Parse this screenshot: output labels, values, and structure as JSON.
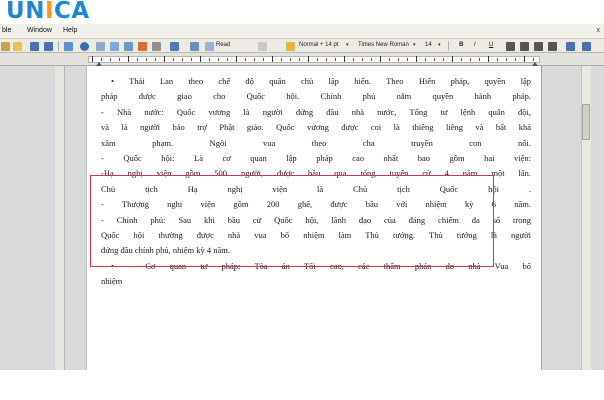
{
  "brand": {
    "logo_u": "U",
    "logo_n": "N",
    "logo_i": "I",
    "logo_c": "C",
    "logo_a": "A"
  },
  "menubar": {
    "item_table": "ble",
    "item_window": "Window",
    "item_help": "Help",
    "right_control": "x"
  },
  "toolbar": {
    "read_label": "Read",
    "style_value": "Normal + 14 pt",
    "font_value": "Times New Roman",
    "size_value": "14",
    "bold": "B",
    "italic": "I",
    "underline": "U"
  },
  "document": {
    "lines": [
      {
        "text": "•  Thái Lan theo chế độ quân chủ lập hiến. Theo Hiến pháp, quyền lập",
        "style": "ind"
      },
      {
        "text": "pháp được giao cho Quốc hội. Chính phủ nắm quyền hành pháp.",
        "style": ""
      },
      {
        "text": "- Nhà nước: Quốc vương là người đứng đầu nhà nước, Tổng tư lệnh quân đội,",
        "style": ""
      },
      {
        "text": "và là người bảo trợ Phật giáo. Quốc vương được coi là thiêng liêng và bất khả",
        "style": ""
      },
      {
        "text": "xâm phạm. Ngôi vua theo cha truyền con nối.",
        "style": ""
      },
      {
        "text": "- Quốc hội: Là cơ quan lập pháp cao nhất bao gồm hai viện:",
        "style": ""
      },
      {
        "text": "-Hạ nghị viện gồm 500 người, được bầu qua tổng tuyển cử 4 năm một lần.",
        "style": ""
      },
      {
        "text": "Chủ tịch Hạ nghị viện là Chủ tịch Quốc hội .",
        "style": ""
      },
      {
        "text": "- Thượng nghị viện gồm 200 ghế, được bầu với nhiệm kỳ 6 năm.",
        "style": ""
      },
      {
        "text": "- Chính phủ: Sau khi bầu cử Quốc hội, lãnh đạo của đảng chiếm đa số trong",
        "style": ""
      },
      {
        "text": "Quốc hội thường được nhà vua bổ nhiệm làm Thủ tướng. Thủ tướng là người",
        "style": ""
      },
      {
        "text": "đứng đầu chính phủ, nhiệm kỳ 4 năm.",
        "style": "last"
      },
      {
        "text": "•  - Cơ quan tư pháp: Tòa án Tối cao, các thẩm phán do nhà Vua bổ",
        "style": "ind"
      },
      {
        "text": "nhiệm",
        "style": "last"
      }
    ]
  },
  "colors": {
    "logo_blue": "#1e88d4",
    "logo_orange": "#f39a1e",
    "highlight_border": "#c9384b",
    "app_background": "#d9d9d9"
  }
}
